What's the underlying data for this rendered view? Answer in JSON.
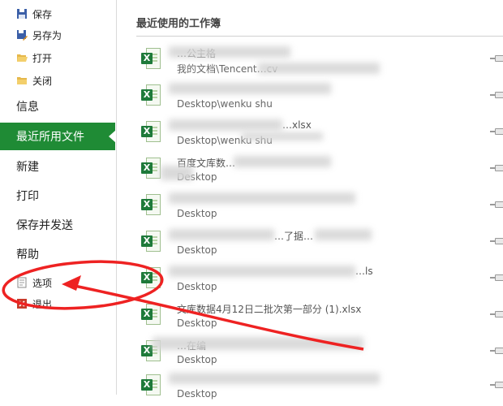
{
  "sidebar": {
    "small_items": [
      {
        "label": "保存",
        "icon": "save-icon"
      },
      {
        "label": "另存为",
        "icon": "save-as-icon"
      },
      {
        "label": "打开",
        "icon": "folder-open-icon"
      },
      {
        "label": "关闭",
        "icon": "folder-close-icon"
      }
    ],
    "big_items": [
      {
        "label": "信息"
      },
      {
        "label": "最近所用文件",
        "active": true
      },
      {
        "label": "新建"
      },
      {
        "label": "打印"
      },
      {
        "label": "保存并发送"
      },
      {
        "label": "帮助"
      }
    ],
    "bottom_items": [
      {
        "label": "选项",
        "icon": "options-icon"
      },
      {
        "label": "退出",
        "icon": "exit-icon"
      }
    ]
  },
  "main": {
    "title": "最近使用的工作簿",
    "recent": [
      {
        "name": "…公主格",
        "path": "我的文档\\Tencent…cv"
      },
      {
        "name": "",
        "path": "Desktop\\wenku shu"
      },
      {
        "name": "…xlsx",
        "path": "Desktop\\wenku shu"
      },
      {
        "name": "百度文库数…",
        "path": "Desktop"
      },
      {
        "name": "",
        "path": "Desktop"
      },
      {
        "name": "…了据…",
        "path": "Desktop"
      },
      {
        "name": "…ls",
        "path": "Desktop"
      },
      {
        "name": "文库数据4月12日二批次第一部分 (1).xlsx",
        "path": "Desktop"
      },
      {
        "name": "…在编",
        "path": "Desktop"
      },
      {
        "name": "",
        "path": "Desktop"
      }
    ]
  },
  "colors": {
    "accent": "#1f8b35",
    "annotation": "#ee2222"
  }
}
